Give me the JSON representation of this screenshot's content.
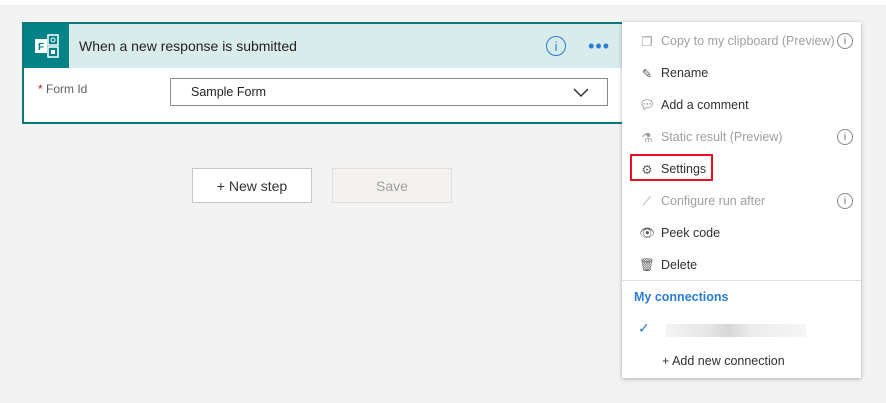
{
  "trigger": {
    "title": "When a new response is submitted",
    "info_icon": "i",
    "field_label": "Form Id",
    "required_mark": "*",
    "field_value": "Sample Form"
  },
  "buttons": {
    "new_step": "+ New step",
    "save": "Save"
  },
  "menu": {
    "items": [
      {
        "label": "Copy to my clipboard (Preview)",
        "icon": "copy-icon",
        "disabled": true,
        "info": true
      },
      {
        "label": "Rename",
        "icon": "pencil-icon",
        "disabled": false,
        "info": false
      },
      {
        "label": "Add a comment",
        "icon": "comment-icon",
        "disabled": false,
        "info": false
      },
      {
        "label": "Static result (Preview)",
        "icon": "flask-icon",
        "disabled": true,
        "info": true
      },
      {
        "label": "Settings",
        "icon": "gear-icon",
        "disabled": false,
        "info": false
      },
      {
        "label": "Configure run after",
        "icon": "run-after-icon",
        "disabled": true,
        "info": true
      },
      {
        "label": "Peek code",
        "icon": "eye-icon",
        "disabled": false,
        "info": false
      },
      {
        "label": "Delete",
        "icon": "trash-icon",
        "disabled": false,
        "info": false
      }
    ],
    "connections_header": "My connections",
    "add_connection": "+ Add new connection",
    "info_glyph": "i"
  },
  "colors": {
    "accent": "#2b7cd3",
    "brand": "#038387",
    "highlight": "#e81123"
  }
}
